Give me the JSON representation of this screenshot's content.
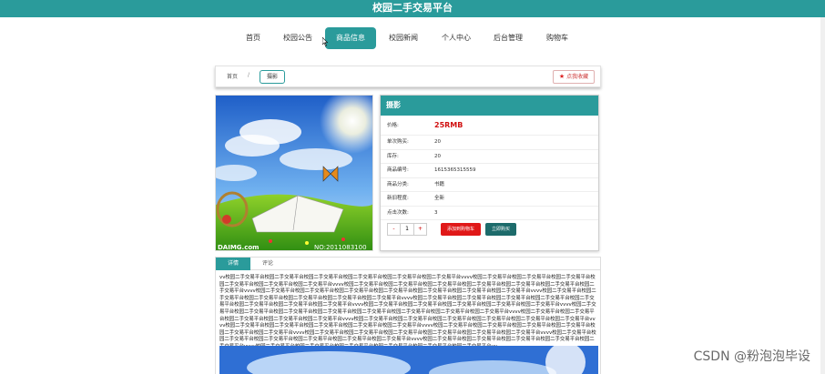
{
  "app": {
    "title": "校园二手交易平台"
  },
  "nav": {
    "items": [
      {
        "label": "首页"
      },
      {
        "label": "校园公告"
      },
      {
        "label": "商品信息"
      },
      {
        "label": "校园新闻"
      },
      {
        "label": "个人中心"
      },
      {
        "label": "后台管理"
      },
      {
        "label": "购物车"
      }
    ],
    "active_index": 2
  },
  "breadcrumb": {
    "home": "首页",
    "separator": "/",
    "current": "摄影",
    "favorite_label": "点我收藏"
  },
  "image": {
    "caption_left": "DAIMG.com",
    "caption_right": "NO:2011083100"
  },
  "product": {
    "title": "摄影",
    "fields": [
      {
        "label": "价格:",
        "value": "25RMB"
      },
      {
        "label": "单次购买:",
        "value": "20"
      },
      {
        "label": "库存:",
        "value": "20"
      },
      {
        "label": "商品编号:",
        "value": "1615365315559"
      },
      {
        "label": "商品分类:",
        "value": "书籍"
      },
      {
        "label": "新旧程度:",
        "value": "全新"
      },
      {
        "label": "点击次数:",
        "value": "3"
      }
    ],
    "quantity": {
      "minus": "-",
      "value": "1",
      "plus": "+"
    },
    "add_to_cart": "添加到购物车",
    "buy_now": "立即购买"
  },
  "details": {
    "tabs": [
      {
        "label": "详情"
      },
      {
        "label": "评论"
      }
    ],
    "text": "vv校园二手交易平台校园二手交易平台校园二手交易平台校园二手交易平台校园二手交易平台校园二手交易平台vvvv校园二手交易平台校园二手交易平台校园二手交易平台校园二手交易平台校园二手交易平台校园二手交易平台vvvv校园二手交易平台校园二手交易平台校园二手交易平台校园二手交易平台校园二手交易平台校园二手交易平台校园二手交易平台vvvv校园二手交易平台校园二手交易平台校园二手交易平台校园二手交易平台校园二手交易平台校园二手交易平台校园二手交易平台vvvv校园二手交易平台校园二手交易平台校园二手交易平台校园二手交易平台校园二手交易平台校园二手交易平台vvvv校园二手交易平台校园二手交易平台校园二手交易平台校园二手交易平台校园二手交易平台校园二手交易平台校园二手交易平台校园二手交易平台vvvv校园二手交易平台校园二手交易平台校园二手交易平台校园二手交易平台校园二手交易平台vvvv校园二手交易平台校园二手交易平台校园二手交易平台校园二手交易平台校园二手交易平台校园二手交易平台校园二手交易平台校园二手交易平台vvvv校园二手交易平台校园二手交易平台校园二手交易平台校园二手交易平台校园二手交易平台vvvv校园二手交易平台校园二手交易平台校园二手交易平台校园二手交易平台校园二手交易平台校园二手交易平台vvvv校园二手交易平台校园二手交易平台校园二手交易平台校园二手交易平台校园二手交易平台vvvv校园二手交易平台校园二手交易平台校园二手交易平台校园二手交易平台校园二手交易平台校园二手交易平台vvvv校园二手交易平台校园二手交易平台校园二手交易平台校园二手交易平台校园二手交易平台校园二手交易平台vvvv校园二手交易平台校园二手交易平台校园二手交易平台校园二手交易平台校园二手交易平台校园二手交易平台vvvv校园二手交易平台校园二手交易平台校园二手交易平台校园二手交易平台校园二手交易平台vvvv校园二手交易平台校园二手交易平台校园二手交易平台校园二手交易平台校园二手交易平台校园二手交易平台vv"
  },
  "watermark": "CSDN @粉泡泡毕设",
  "colors": {
    "accent": "#2a9b9b",
    "price": "#d01010",
    "cart_button": "#e01818",
    "buy_button": "#1d6b6b"
  }
}
